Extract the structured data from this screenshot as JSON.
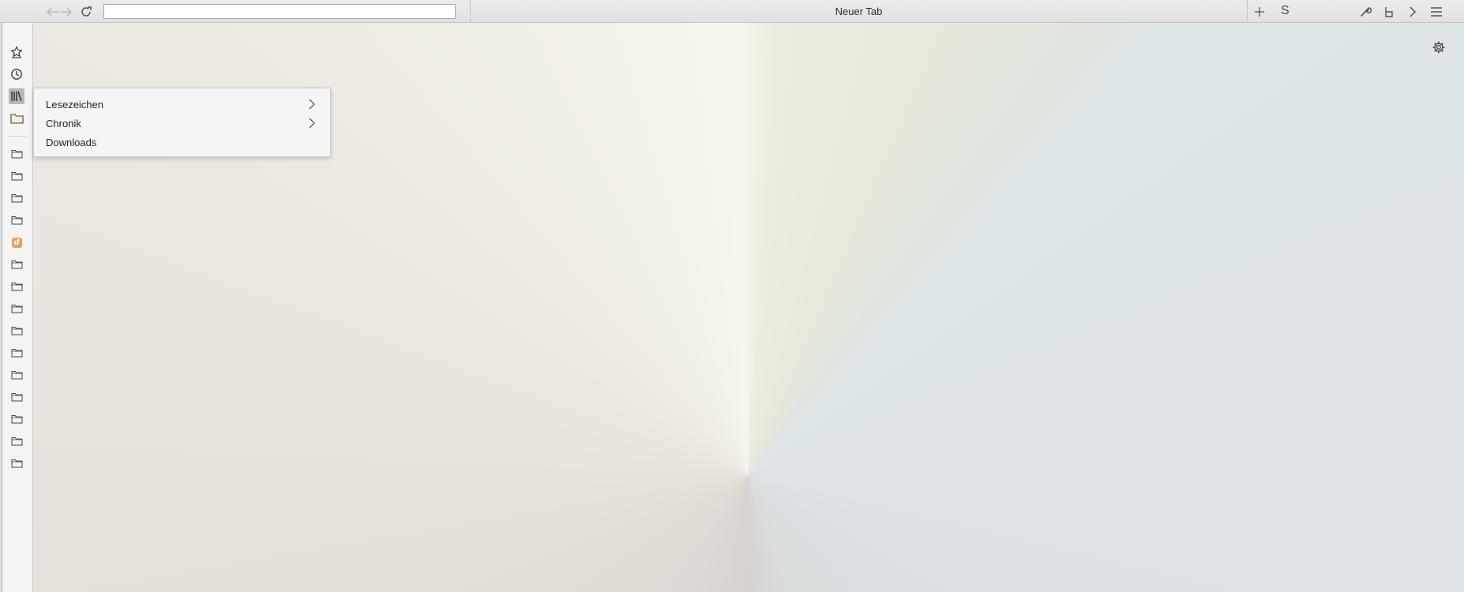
{
  "window": {
    "tab_title": "Neuer Tab",
    "url_value": "",
    "search_label": "S"
  },
  "toolbar": {
    "back_icon": "arrow-left-icon",
    "forward_icon": "arrow-right-icon",
    "reload_icon": "reload-icon",
    "new_tab_icon": "plus-icon",
    "right_icons": [
      "wrench-icon",
      "bookmark-flag-icon",
      "chevron-right-icon",
      "hamburger-menu-icon"
    ]
  },
  "sidebar": {
    "top_icons": [
      "bookmarks-star-icon",
      "history-clock-icon",
      "library-icon",
      "folder-icon"
    ],
    "folder_count": 15,
    "special_item": {
      "position": 5,
      "label": "d"
    }
  },
  "library_menu": {
    "items": [
      {
        "label": "Lesezeichen",
        "has_submenu": true
      },
      {
        "label": "Chronik",
        "has_submenu": true
      },
      {
        "label": "Downloads",
        "has_submenu": false
      }
    ]
  },
  "colors": {
    "toolbar_bg": "#e6e6e6",
    "sidebar_bg": "#f4f4f4",
    "menu_bg": "#f5f5f5",
    "active_icon_bg": "#b7b7b7",
    "badge_orange": "#e8a060"
  }
}
